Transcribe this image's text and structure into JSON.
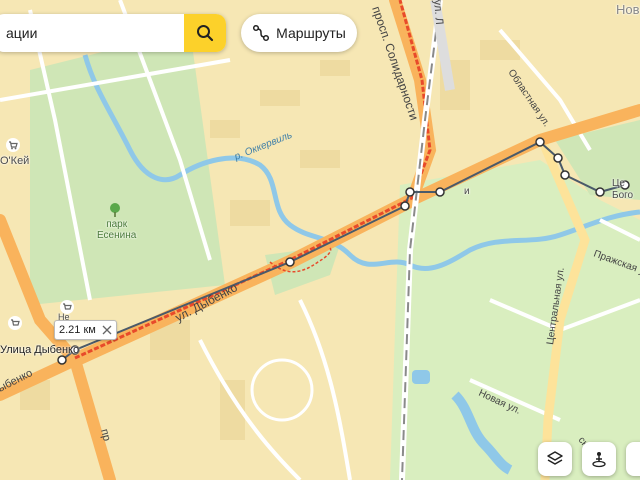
{
  "search": {
    "value": "ации"
  },
  "routes": {
    "label": "Маршруты"
  },
  "measure": {
    "distance": "2.21 км"
  },
  "labels": {
    "prosp_solidarnosti": "просп. Солидарности",
    "ul_l": "ул. Л",
    "oblastnaya_ul": "Областная ул.",
    "r_okkervil": "р. Оккервиль",
    "park_esenina": "парк\nЕсенина",
    "okey": "О'Кей",
    "ul_dybenko": "ул. Дыбенко",
    "metro_dybenko": "Улица Дыбенко",
    "dybenko_edge": "ыбенко",
    "prazhskaya_ul": "Пражская ул.",
    "centralnaya_ul": "Центральная ул.",
    "novaya_ul": "Новая ул.",
    "top_right": "Нов",
    "ne_label": "Не",
    "pr_bottom": "пр",
    "kirsk_label": "ский пер",
    "ce_label": "Це",
    "bog_label": "Бого",
    "i_label": "и"
  },
  "icons": {
    "search": "search-icon",
    "routes": "route-icon",
    "close": "close-icon",
    "layers": "layers-icon",
    "panorama": "panorama-icon",
    "shop": "shopping-cart-icon",
    "tree": "park-tree-icon"
  },
  "colors": {
    "route_line": "#e84a2a",
    "measure_line": "#4a5a6a",
    "road_major": "#f9b35c",
    "road_minor": "#ffffff",
    "park": "#cfe6b6",
    "water": "#8fc8e8",
    "accent": "#fcd12a"
  }
}
